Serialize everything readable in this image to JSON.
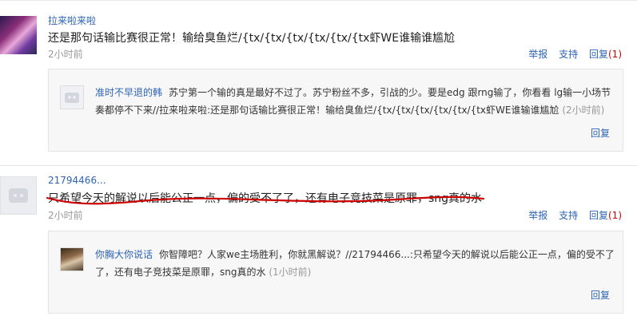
{
  "comments": [
    {
      "username": "拉来啦来啦",
      "text": "还是那句话输比赛很正常！输给臭鱼烂/{tx/{tx/{tx/{tx/{tx/{tx虾WE谁输谁尴尬",
      "time": "2小时前",
      "report": "举报",
      "support": "支持",
      "reply_label": "回复",
      "reply_count_open": "(",
      "reply_count": "1",
      "reply_count_close": ")",
      "reply": {
        "username": "准时不早退的韩",
        "text": "苏宁第一个输的真是最好不过了。苏宁粉丝不多，引战的少。要是edg 跟rng输了，你看看 lg输一小场节奏都停不下来//拉来啦来啦:还是那句话输比赛很正常！输给臭鱼烂/{tx/{tx/{tx/{tx/{tx/{tx虾WE谁输谁尴尬",
        "time": "(2小时前)",
        "reply_label": "回复"
      }
    },
    {
      "username": "21794466...",
      "text": "只希望今天的解说以后能公正一点，偏的受不了了，还有电子竞技菜是原罪，sng真的水",
      "time": "2小时前",
      "report": "举报",
      "support": "支持",
      "reply_label": "回复",
      "reply_count_open": "(",
      "reply_count": "1",
      "reply_count_close": ")",
      "reply": {
        "username": "你胸大你说话",
        "text": "你智障吧？人家we主场胜利，你就黑解说？//21794466...:只希望今天的解说以后能公正一点，偏的受不了了，还有电子竞技菜是原罪，sng真的水",
        "time": "(1小时前)",
        "reply_label": "回复"
      }
    }
  ],
  "colors": {
    "link": "#2d64b3",
    "count": "#d30000",
    "annotation_line": "#cc0000"
  }
}
